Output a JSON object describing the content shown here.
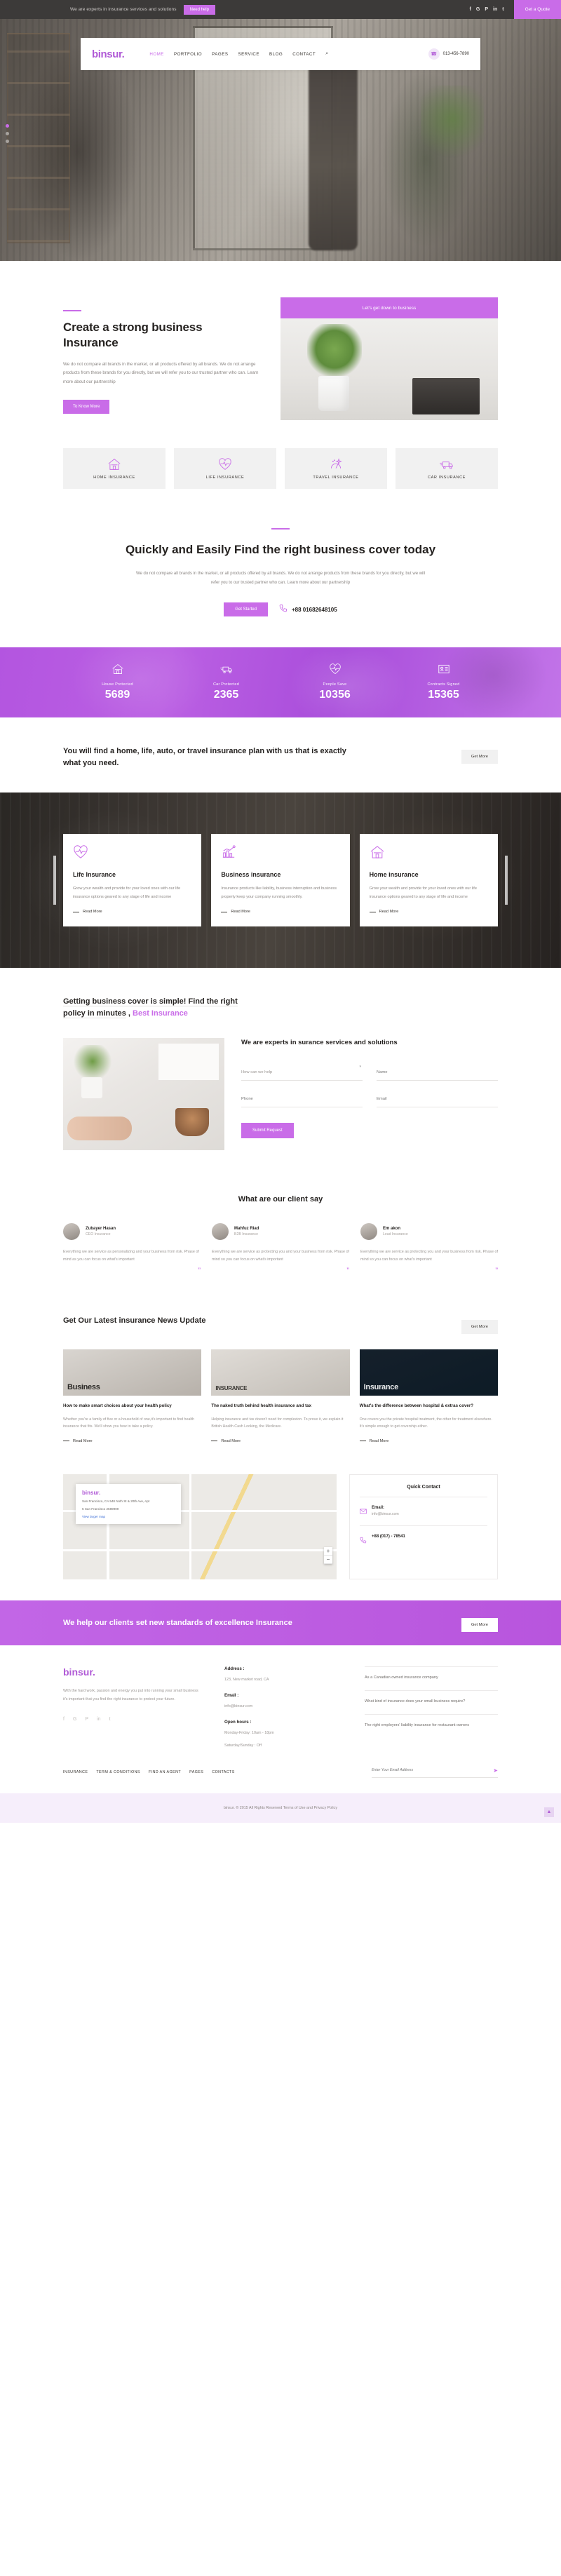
{
  "topbar": {
    "tagline": "We are experts in insurance services and solutions",
    "need_help": "Need help",
    "get_quote": "Get a Quote",
    "social": [
      "f",
      "G",
      "P",
      "in",
      "t"
    ]
  },
  "header": {
    "logo": "binsur.",
    "nav": [
      {
        "label": "HOME",
        "active": true
      },
      {
        "label": "PORTFOLIO",
        "active": false
      },
      {
        "label": "PAGES",
        "active": false
      },
      {
        "label": "SERVICE",
        "active": false
      },
      {
        "label": "BLOG",
        "active": false
      },
      {
        "label": "CONTACT",
        "active": false
      }
    ],
    "search_icon": "⌕",
    "phone": "013-456-7890",
    "phone_icon": "☎"
  },
  "intro": {
    "heading": "Create a strong business Insurance",
    "body": "We do not compare all brands in the market, or all products offered by all brands. We do not arrange products from these brands for you directly, but we will refer you to our trusted partner who can. Learn more about our partnership",
    "button": "To Know More",
    "promo_tag": "Let's get down to business"
  },
  "services": [
    {
      "label": "HOME INSURANCE",
      "icon": "home-icon"
    },
    {
      "label": "LIFE INSURANCE",
      "icon": "heart-pulse-icon"
    },
    {
      "label": "TRAVEL INSURANCE",
      "icon": "travel-icon"
    },
    {
      "label": "CAR INSURANCE",
      "icon": "truck-icon"
    }
  ],
  "quick": {
    "heading": "Quickly and Easily Find the right business cover today",
    "body": "We do not compare all brands in the market, or all products offered by all brands. We do not arrange products from these brands for you directly, but we will refer you to our trusted partner who can. Learn more about our partnership",
    "button": "Get Started",
    "phone": "+88 01682648105"
  },
  "stats": [
    {
      "caption": "House Protected",
      "value": "5689",
      "icon": "home-icon"
    },
    {
      "caption": "Car Protected",
      "value": "2365",
      "icon": "truck-icon"
    },
    {
      "caption": "People Save",
      "value": "10356",
      "icon": "heart-pulse-icon"
    },
    {
      "caption": "Contracts Signed",
      "value": "15365",
      "icon": "id-card-icon"
    }
  ],
  "strip": {
    "heading": "You will find a home, life, auto, or travel insurance plan with us that is exactly what you need.",
    "button": "Get More"
  },
  "insurance_cards": [
    {
      "title": "Life Insurance",
      "icon": "heart-pulse-icon",
      "body": "Grow your wealth and provide for your loved ones with our life insurance options geared to any stage of life and income",
      "readmore": "Read More"
    },
    {
      "title": "Business insurance",
      "icon": "bar-chart-icon",
      "body": "Insurance products like liability, business interruption and business property keep your company running smoothly.",
      "readmore": "Read More"
    },
    {
      "title": "Home insurance",
      "icon": "home-icon",
      "body": "Grow your wealth and provide for your loved ones with our life insurance options geared to any stage of life and income",
      "readmore": "Read More"
    }
  ],
  "form": {
    "heading_line1": "Getting business cover is simple! Find the right",
    "heading_line2": "policy in minutes",
    "heading_accent": "Best Insurance",
    "heading_comma": " , ",
    "subtitle": "We are experts in surance services and solutions",
    "select_value": "How can we help",
    "select_caret": "▾",
    "name_placeholder": "Name",
    "phone_placeholder": "Phone",
    "email_placeholder": "Email",
    "submit": "Submit Request"
  },
  "clients": {
    "heading": "What are our client say",
    "items": [
      {
        "name": "Zubayer Hasan",
        "role": "CEO Insurance",
        "text": "Everything we are service as personalizing and your business from risk. Phase of mind as you can focus on what's important",
        "quote": "”"
      },
      {
        "name": "Mahfuz Riad",
        "role": "B2B Insurance",
        "text": "Everything we are service as protecting you and your business from risk. Phase of mind so you can focus on what's important",
        "quote": "”"
      },
      {
        "name": "Em akon",
        "role": "Lead Insurance",
        "text": "Everything we are service as protecting you and your business from risk. Phase of mind so you can focus on what's important",
        "quote": "”"
      }
    ]
  },
  "news": {
    "heading": "Get Our Latest insurance News Update",
    "button": "Get More",
    "items": [
      {
        "image_word": "Business",
        "title": "How to make smart choices about your health policy",
        "body": "Whether you're a family of five or a household of one,it's important to find health insurance that fits. We'll show you how to take a policy.",
        "readmore": "Read More"
      },
      {
        "image_word": "INSURANCE",
        "title": "The naked truth behind health insurance and tax",
        "body": "Helping insurance and tax doesn't need for complexion. To prove it, we explain it British Health Cash Looking, the Medicare.",
        "readmore": "Read More"
      },
      {
        "image_word": "Insurance",
        "title": "What's the difference between hospital & extras cover?",
        "body": "One covers you the private hospital treatment, the other for treatment elsewhere. It's simple enough to get covership either.",
        "readmore": "Read More"
      }
    ]
  },
  "map": {
    "card_logo": "binsur.",
    "address_line1": "San Francisco, CA 548 Noth St & 20th Ave, Apt",
    "address_line2": "5 San Francisco 2589909",
    "link": "View larger map",
    "zoom_in": "+",
    "zoom_out": "−"
  },
  "quick_contact": {
    "title": "Quick Contact",
    "email_label": "Email:",
    "email_value": "info@binsur.com",
    "phone_label": "+88  (017) - 78541",
    "email_icon": "envelope-icon",
    "phone_icon": "phone-icon"
  },
  "cta": {
    "heading": "We help our clients set new standards of excellence Insurance",
    "button": "Get More"
  },
  "footer": {
    "logo": "binsur.",
    "about": "With the hard work, passion and energy you put into running your small business it's important that you find the right insurance to protect your future.",
    "social": [
      "f",
      "G",
      "P",
      "in",
      "t"
    ],
    "address_label": "Address :",
    "address_value": "123, New market road, CA",
    "email_label": "Email :",
    "email_value": "info@binsur.com",
    "hours_label": "Open hours :",
    "hours_value1": "Monday-Friday: 10am - 18pm",
    "hours_value2": "Saturday/Sunday : Off",
    "news_items": [
      "As a Canadian owned insurance company",
      "What kind of insurance does your small business require?",
      "The right employers' liability insurance for restaurant owners"
    ],
    "links": [
      "INSURANCE",
      "TERM & CONDITIONS",
      "FIND AN AGENT",
      "PAGES",
      "CONTACTS"
    ],
    "subscribe_placeholder": "Enter Your Email Address",
    "send_icon": "➤",
    "copyright": "binsur. © 2015 All Rights Reserved Terms of Use and Privacy Policy",
    "to_top": "▲"
  },
  "colors": {
    "accent": "#c96ce8",
    "accent_dark": "#b05ad6",
    "dark": "#3c3a39",
    "light_gray": "#f1f1f1"
  }
}
